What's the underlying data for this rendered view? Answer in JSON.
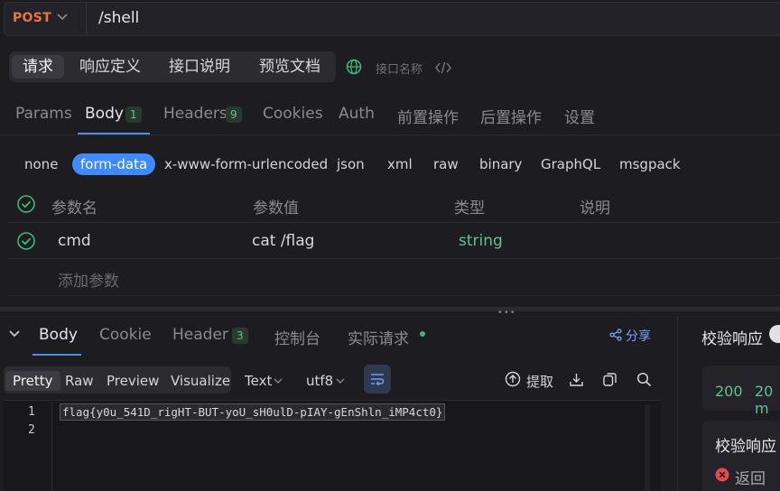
{
  "request": {
    "method": "POST",
    "url": "/shell"
  },
  "top_tabs": [
    {
      "label": "请求",
      "active": true
    },
    {
      "label": "响应定义"
    },
    {
      "label": "接口说明"
    },
    {
      "label": "预览文档"
    }
  ],
  "interface_name_placeholder": "接口名称",
  "request_tabs": [
    {
      "label": "Params"
    },
    {
      "label": "Body",
      "badge": "1",
      "active": true
    },
    {
      "label": "Headers",
      "badge": "9"
    },
    {
      "label": "Cookies"
    },
    {
      "label": "Auth"
    },
    {
      "label": "前置操作"
    },
    {
      "label": "后置操作"
    },
    {
      "label": "设置"
    }
  ],
  "body_types": [
    {
      "label": "none"
    },
    {
      "label": "form-data",
      "active": true
    },
    {
      "label": "x-www-form-urlencoded"
    },
    {
      "label": "json"
    },
    {
      "label": "xml"
    },
    {
      "label": "raw"
    },
    {
      "label": "binary"
    },
    {
      "label": "GraphQL"
    },
    {
      "label": "msgpack"
    }
  ],
  "params_table": {
    "headers": [
      "参数名",
      "参数值",
      "类型",
      "说明"
    ],
    "rows": [
      {
        "name": "cmd",
        "value": "cat /flag",
        "type": "string",
        "desc": ""
      }
    ],
    "add_label": "添加参数"
  },
  "response_tabs": [
    {
      "label": "Body",
      "active": true
    },
    {
      "label": "Cookie"
    },
    {
      "label": "Header",
      "badge": "3"
    },
    {
      "label": "控制台"
    },
    {
      "label": "实际请求",
      "dot": true
    }
  ],
  "share_label": "分享",
  "view_tabs": [
    {
      "label": "Pretty",
      "active": true
    },
    {
      "label": "Raw"
    },
    {
      "label": "Preview"
    },
    {
      "label": "Visualize"
    }
  ],
  "format": "Text",
  "encoding": "utf8",
  "extract_label": "提取",
  "code": {
    "line_numbers": [
      "1",
      "2"
    ],
    "line1": "flag{y0u_541D_rigHT-BUT-yoU_sH0ulD-pIAY-gEnShln_iMP4ct0}"
  },
  "verify": {
    "title": "校验响应",
    "status": "200",
    "time": "20 m",
    "subtitle": "校验响应",
    "error_text": "返回的"
  },
  "colors": {
    "method": "#e8773a",
    "accent": "#3d8bff",
    "success": "#5fc48d",
    "error": "#e5484d"
  }
}
